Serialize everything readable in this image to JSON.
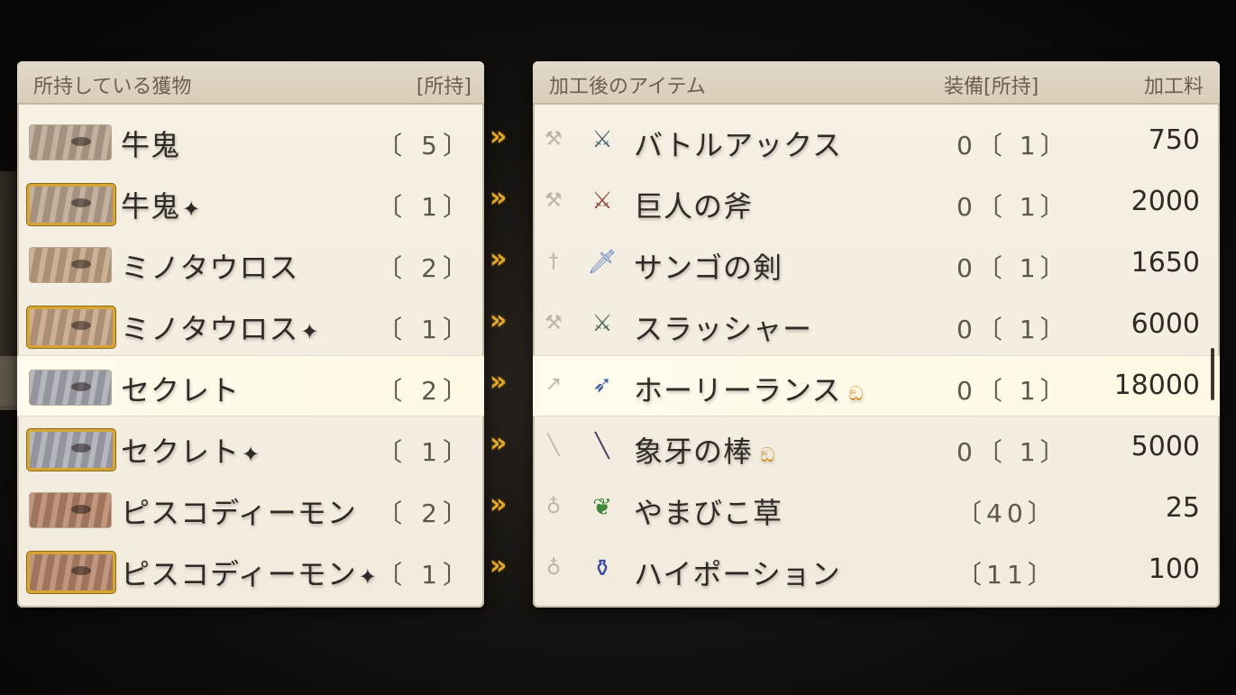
{
  "left": {
    "header_title": "所持している獲物",
    "header_count": "[所持]",
    "items": [
      {
        "name": "牛鬼",
        "sparkle": "",
        "count": "〔 5〕",
        "gold": false,
        "tone": "#b9a58f"
      },
      {
        "name": "牛鬼",
        "sparkle": "✦",
        "count": "〔 1〕",
        "gold": true,
        "tone": "#b9a58f"
      },
      {
        "name": "ミノタウロス",
        "sparkle": "",
        "count": "〔 2〕",
        "gold": false,
        "tone": "#c3a384"
      },
      {
        "name": "ミノタウロス",
        "sparkle": "✦",
        "count": "〔 1〕",
        "gold": true,
        "tone": "#c3a384"
      },
      {
        "name": "セクレト",
        "sparkle": "",
        "count": "〔 2〕",
        "gold": false,
        "tone": "#a9a9b4"
      },
      {
        "name": "セクレト",
        "sparkle": "✦",
        "count": "〔 1〕",
        "gold": true,
        "tone": "#a9a9b4"
      },
      {
        "name": "ピスコディーモン",
        "sparkle": "",
        "count": "〔 2〕",
        "gold": false,
        "tone": "#b58468"
      },
      {
        "name": "ピスコディーモン",
        "sparkle": "✦",
        "count": "〔 1〕",
        "gold": true,
        "tone": "#b58468"
      }
    ]
  },
  "arrow_glyph": "»",
  "right": {
    "header_title": "加工後のアイテム",
    "header_equip": "装備[所持]",
    "header_fee": "加工料",
    "items": [
      {
        "name": "バトルアックス",
        "badge": "",
        "equip": "0〔 1〕",
        "fee": "750",
        "category_icon": "axe-icon",
        "icon": "battle-axe-icon"
      },
      {
        "name": "巨人の斧",
        "badge": "",
        "equip": "0〔 1〕",
        "fee": "2000",
        "category_icon": "axe-icon",
        "icon": "giant-axe-icon"
      },
      {
        "name": "サンゴの剣",
        "badge": "",
        "equip": "0〔 1〕",
        "fee": "1650",
        "category_icon": "sword-icon",
        "icon": "coral-sword-icon"
      },
      {
        "name": "スラッシャー",
        "badge": "",
        "equip": "0〔 1〕",
        "fee": "6000",
        "category_icon": "axe-icon",
        "icon": "slasher-icon"
      },
      {
        "name": "ホーリーランス",
        "badge": "ඞ",
        "equip": "0〔 1〕",
        "fee": "18000",
        "category_icon": "spear-icon",
        "icon": "holy-lance-icon"
      },
      {
        "name": "象牙の棒",
        "badge": "ඞ",
        "equip": "0〔 1〕",
        "fee": "5000",
        "category_icon": "staff-icon",
        "icon": "ivory-staff-icon"
      },
      {
        "name": "やまびこ草",
        "badge": "",
        "equip": "〔40〕",
        "fee": "25",
        "category_icon": "flask-icon",
        "icon": "herb-icon"
      },
      {
        "name": "ハイポーション",
        "badge": "",
        "equip": "〔11〕",
        "fee": "100",
        "category_icon": "flask-icon",
        "icon": "potion-icon"
      }
    ]
  },
  "selected_row": 4
}
